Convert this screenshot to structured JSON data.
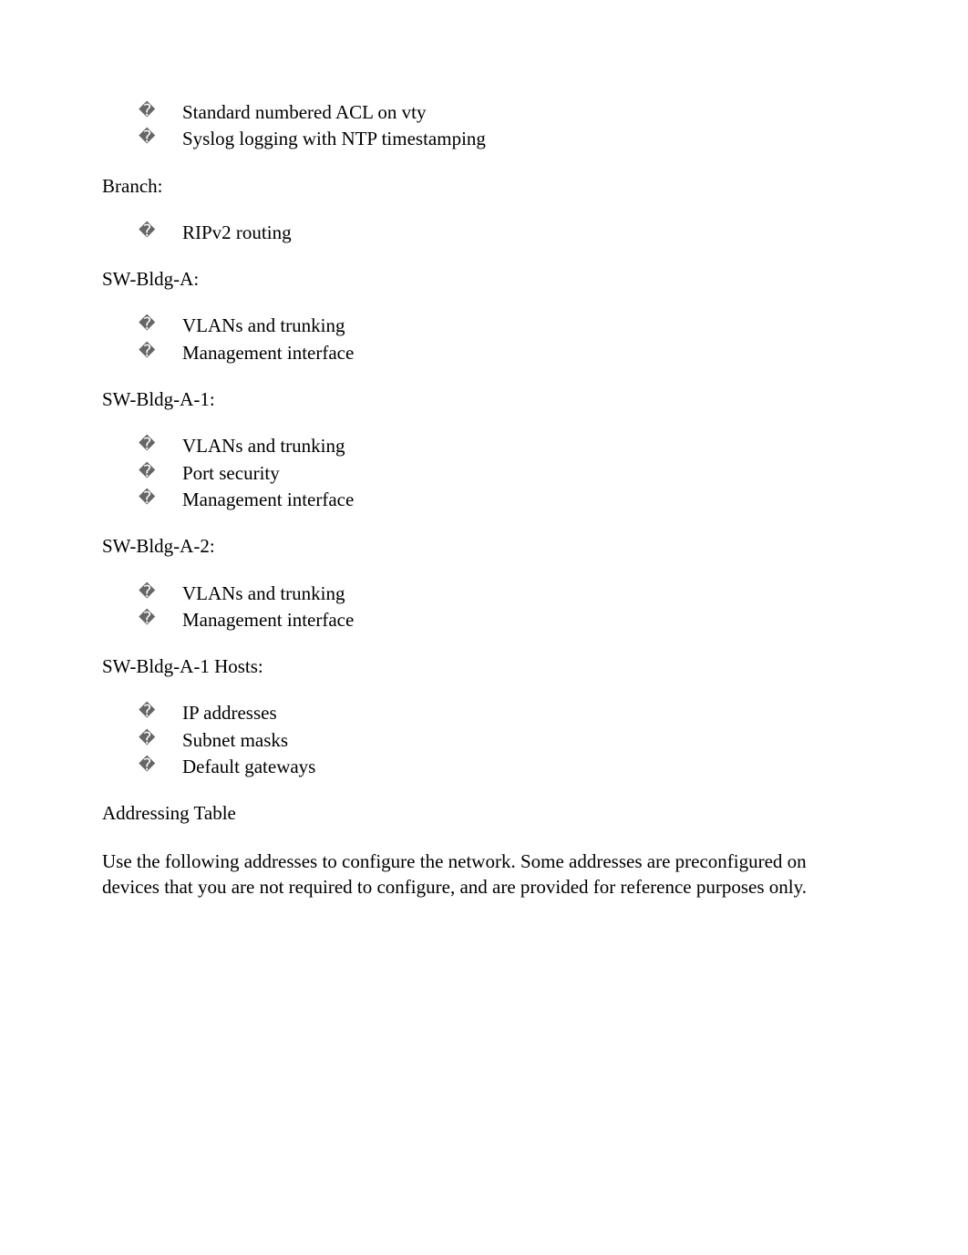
{
  "bullet_glyph": "�",
  "top_list": {
    "items": [
      "Standard numbered ACL on vty",
      "Syslog logging with NTP timestamping"
    ]
  },
  "sections": [
    {
      "label": "Branch:",
      "items": [
        "RIPv2 routing"
      ]
    },
    {
      "label": "SW-Bldg-A:",
      "items": [
        "VLANs and trunking",
        "Management interface"
      ]
    },
    {
      "label": "SW-Bldg-A-1:",
      "items": [
        "VLANs and trunking",
        "Port security",
        "Management interface"
      ]
    },
    {
      "label": "SW-Bldg-A-2:",
      "items": [
        "VLANs and trunking",
        "Management interface"
      ]
    },
    {
      "label": "SW-Bldg-A-1 Hosts:",
      "items": [
        "IP addresses",
        "Subnet masks",
        "Default gateways"
      ]
    }
  ],
  "heading": "Addressing Table",
  "paragraph": "Use the following addresses to configure the network. Some addresses are preconfigured on devices that you are not required to configure, and are provided for reference purposes only."
}
